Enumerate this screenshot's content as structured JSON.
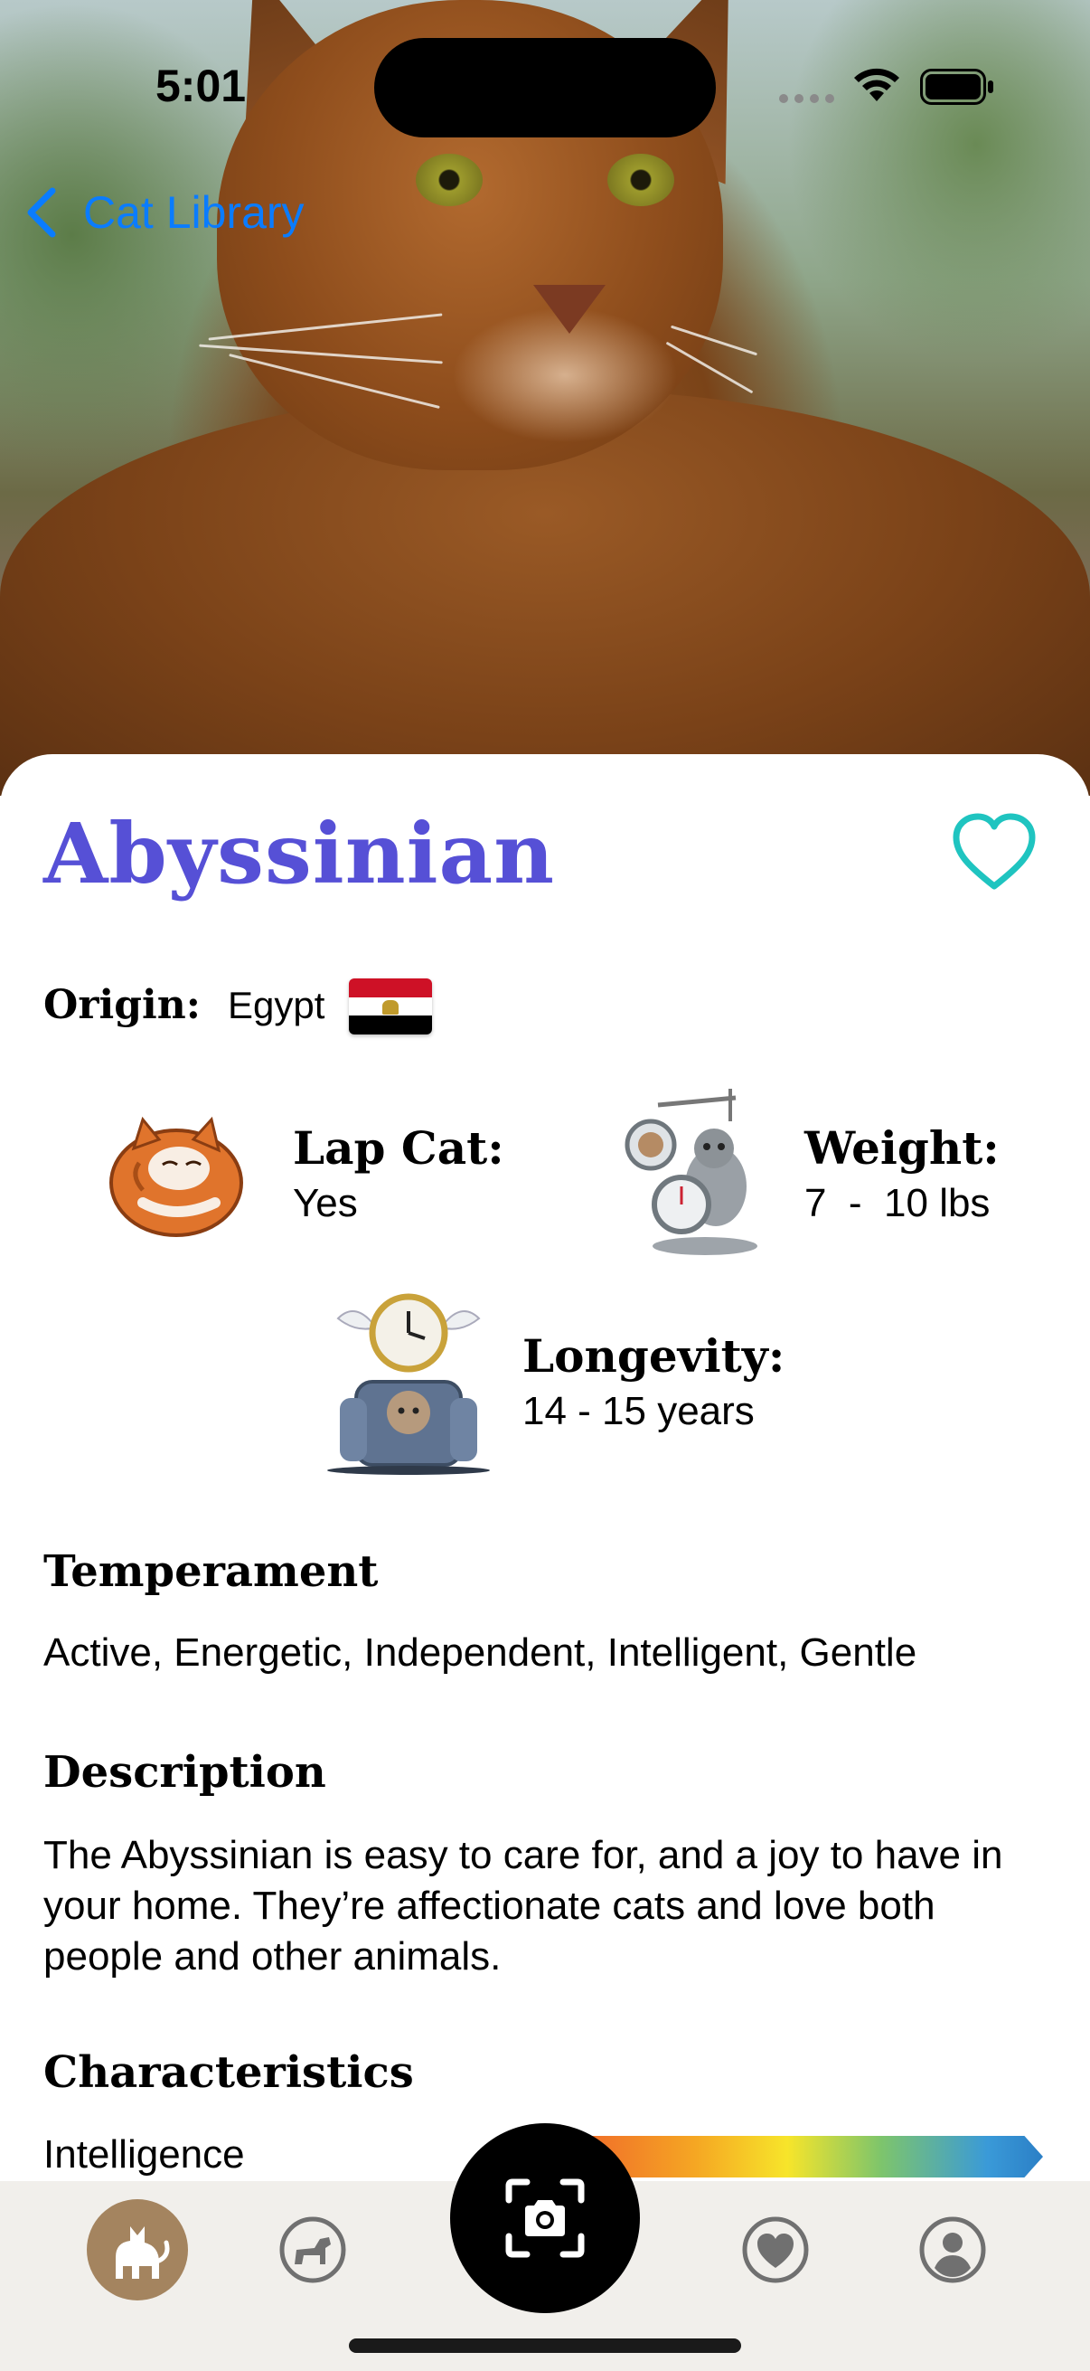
{
  "status_bar": {
    "time": "5:01"
  },
  "nav": {
    "back_label": "Cat Library"
  },
  "breed": {
    "name": "Abyssinian",
    "origin_label": "Origin:",
    "origin_value": "Egypt",
    "is_favorite": false
  },
  "stats": {
    "lap_cat": {
      "label": "Lap Cat:",
      "value": "Yes"
    },
    "weight": {
      "label": "Weight:",
      "value": "7  -  10 lbs"
    },
    "longevity": {
      "label": "Longevity:",
      "value": "14 - 15 years"
    }
  },
  "temperament": {
    "title": "Temperament",
    "text": "Active, Energetic, Independent, Intelligent, Gentle"
  },
  "description": {
    "title": "Description",
    "text": "The Abyssinian is easy to care for, and a joy to have in your home. They’re affectionate cats and love both people and other animals."
  },
  "characteristics": {
    "title": "Characteristics",
    "items": [
      {
        "label": "Intelligence"
      }
    ]
  },
  "tabbar": {
    "items": [
      {
        "name": "cats",
        "icon": "cat-icon",
        "active": true
      },
      {
        "name": "dogs",
        "icon": "dog-icon",
        "active": false
      },
      {
        "name": "camera",
        "icon": "camera-scan-icon",
        "active": false
      },
      {
        "name": "favorites",
        "icon": "heart-icon",
        "active": false
      },
      {
        "name": "profile",
        "icon": "person-icon",
        "active": false
      }
    ]
  },
  "colors": {
    "accent_title": "#5650d6",
    "link_blue": "#0a7cff",
    "favorite_teal": "#1fc4c0",
    "active_tab": "#a4845f",
    "egypt_flag": [
      "#ce1126",
      "#ffffff",
      "#000000"
    ]
  }
}
